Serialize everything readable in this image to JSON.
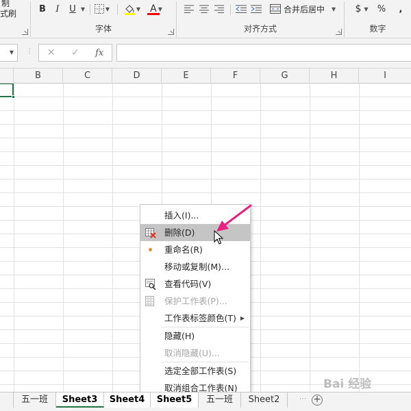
{
  "ribbon": {
    "clipboard": {
      "format_painter_label": "式刷"
    },
    "font": {
      "group_label": "字体",
      "bold": "B",
      "italic": "I",
      "underline": "U",
      "font_color_glyph": "A",
      "fill_color": "#ffff00",
      "font_color": "#ff0000"
    },
    "alignment": {
      "group_label": "对齐方式",
      "merge_center_label": "合并后居中"
    },
    "number": {
      "group_label": "数字",
      "currency_symbol": "$",
      "percent_symbol": "%",
      "comma_symbol": ","
    }
  },
  "formula_bar": {
    "cancel_glyph": "✕",
    "enter_glyph": "✓",
    "fx_label": "fx",
    "value": ""
  },
  "grid": {
    "columns": [
      "B",
      "C",
      "D",
      "E",
      "F",
      "G",
      "H",
      "I"
    ]
  },
  "context_menu": {
    "items": [
      {
        "label": "插入(I)...",
        "disabled": false
      },
      {
        "label": "删除(D)",
        "disabled": false,
        "hovered": true,
        "icon": "delete-sheet-icon"
      },
      {
        "label": "重命名(R)",
        "disabled": false,
        "icon": "bullet-icon"
      },
      {
        "label": "移动或复制(M)...",
        "disabled": false
      },
      {
        "label": "查看代码(V)",
        "disabled": false,
        "icon": "view-code-icon"
      },
      {
        "label": "保护工作表(P)...",
        "disabled": true,
        "icon": "protect-sheet-icon"
      },
      {
        "label": "工作表标签颜色(T)",
        "disabled": false,
        "submenu": true
      },
      {
        "label": "隐藏(H)",
        "disabled": false
      },
      {
        "label": "取消隐藏(U)...",
        "disabled": true
      },
      {
        "label": "选定全部工作表(S)",
        "disabled": false
      },
      {
        "label": "取消组合工作表(N)",
        "disabled": false
      }
    ]
  },
  "sheet_tabs": {
    "tabs": [
      {
        "label": "五一班"
      },
      {
        "label": "Sheet3"
      },
      {
        "label": "Sheet4"
      },
      {
        "label": "Sheet5"
      },
      {
        "label": "五一班"
      },
      {
        "label": "Sheet2"
      }
    ],
    "add_glyph": "+"
  },
  "colors": {
    "accent_green": "#217346",
    "annotation_pink": "#e8217f",
    "menu_hover": "#c5c5c5"
  },
  "watermark": {
    "text": "Bai 经验"
  }
}
